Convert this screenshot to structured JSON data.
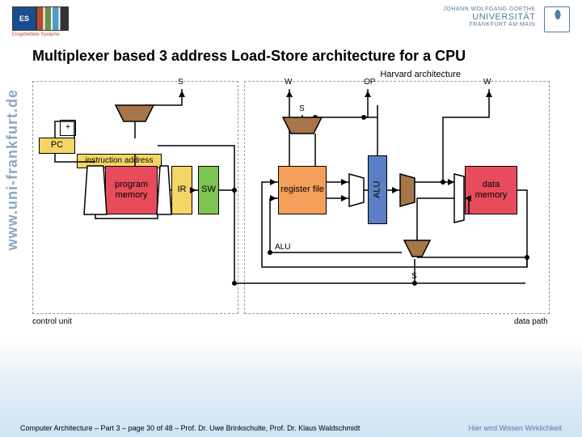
{
  "header": {
    "logo_es": "ES",
    "logo_subtitle": "Eingebettete Systeme",
    "goethe": "JOHANN WOLFGANG GOETHE",
    "university": "UNIVERSITÄT",
    "city": "FRANKFURT AM MAIN"
  },
  "sidebar_url": "www.uni-frankfurt.de",
  "title": "Multiplexer based 3 address Load-Store architecture for a CPU",
  "diagram": {
    "arch_label": "Harvard architecture",
    "control_unit": "control unit",
    "data_path": "data path",
    "signals": {
      "s_top": "S",
      "w1": "W",
      "s_mid": "S",
      "op": "OP",
      "w2": "W",
      "s_bot": "S",
      "alu_label": "ALU"
    },
    "blocks": {
      "pc": "PC",
      "instr_addr": "instruction address",
      "plus": "+",
      "program_memory": "program memory",
      "ir": "IR",
      "sw": "SW",
      "register_file": "register file",
      "alu": "ALU",
      "data_memory": "data memory"
    }
  },
  "footer": {
    "left": "Computer Architecture – Part 3 – page 30 of 48 – Prof. Dr. Uwe Brinkschulte, Prof. Dr. Klaus Waldschmidt",
    "right": "Hier wird Wissen Wirklichkeit"
  }
}
